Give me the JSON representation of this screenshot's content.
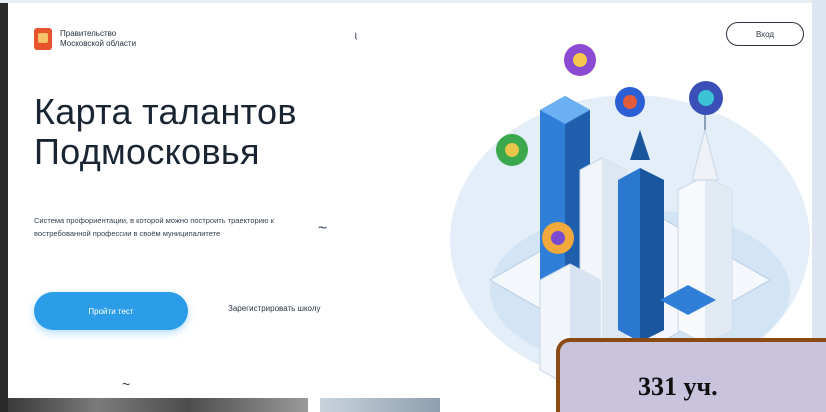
{
  "header": {
    "logo_line1": "Правительство",
    "logo_line2": "Московской области",
    "login_label": "Вход"
  },
  "hero": {
    "title_line1": "Карта талантов",
    "title_line2": "Подмосковья",
    "subtitle": "Система профориентации, в которой можно построить траекторию к востребованной профессии в своём муниципалитете",
    "primary_cta": "Пройти тест",
    "secondary_cta": "Зарегистрировать школу"
  },
  "badge": {
    "text": "331 уч."
  },
  "colors": {
    "accent": "#2b9de8",
    "logo": "#e7532b",
    "badge_bg": "#c9c3dd",
    "badge_border": "#8b4a13"
  },
  "icons": {
    "logo": "coat-of-arms-icon",
    "illustration": "isometric-city-illustration"
  }
}
